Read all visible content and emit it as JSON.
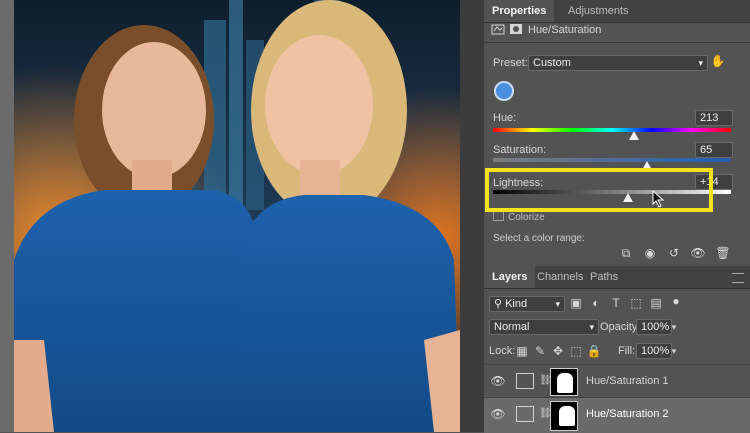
{
  "properties": {
    "tabs": [
      "Properties",
      "Adjustments"
    ],
    "adjustment_title": "Hue/Saturation",
    "preset_label": "Preset:",
    "preset_value": "Custom",
    "hue_label": "Hue:",
    "hue_value": "213",
    "saturation_label": "Saturation:",
    "saturation_value": "65",
    "lightness_label": "Lightness:",
    "lightness_value": "+14",
    "colorize_label": "Colorize",
    "color_range_label": "Select a color range:"
  },
  "layers": {
    "tabs": [
      "Layers",
      "Channels",
      "Paths"
    ],
    "filter_kind": "Kind",
    "blend_mode": "Normal",
    "opacity_label": "Opacity:",
    "opacity_value": "100%",
    "lock_label": "Lock:",
    "fill_label": "Fill:",
    "fill_value": "100%",
    "items": [
      {
        "name": "Hue/Saturation 1"
      },
      {
        "name": "Hue/Saturation 2"
      }
    ]
  },
  "icons": [
    "adjustment-icon",
    "mask-icon",
    "hand-tool-icon",
    "eyedropper-icon",
    "clip-layer-icon",
    "view-previous-icon",
    "reset-icon",
    "visibility-icon",
    "trash-icon",
    "visibility-icon",
    "link-icon"
  ],
  "colors": {
    "highlight": "#f3e21a",
    "shirt_blue": "#1b5fa8",
    "panel_bg": "#535353"
  }
}
